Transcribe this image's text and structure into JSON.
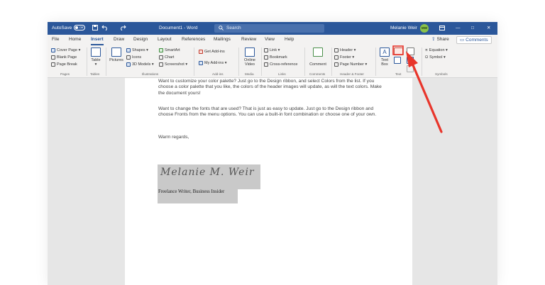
{
  "titlebar": {
    "autosave": "AutoSave",
    "autosave_state": "Off",
    "document_name": "Document1  -  Word",
    "search_placeholder": "Search",
    "user_name": "Melanie Weir",
    "user_initials": "MW",
    "minimize": "—",
    "restore": "□",
    "close": "✕"
  },
  "menu": {
    "tabs": [
      "File",
      "Home",
      "Insert",
      "Draw",
      "Design",
      "Layout",
      "References",
      "Mailings",
      "Review",
      "View",
      "Help"
    ],
    "active": "Insert",
    "share": "Share",
    "comments": "Comments"
  },
  "ribbon": {
    "pages": {
      "cover_page": "Cover Page",
      "blank_page": "Blank Page",
      "page_break": "Page Break",
      "label": "Pages"
    },
    "tables": {
      "table": "Table",
      "label": "Tables"
    },
    "illustrations": {
      "pictures": "Pictures",
      "shapes": "Shapes",
      "icons": "Icons",
      "models_3d": "3D Models",
      "smartart": "SmartArt",
      "chart": "Chart",
      "screenshot": "Screenshot",
      "label": "Illustrations"
    },
    "addins": {
      "get_addins": "Get Add-ins",
      "my_addins": "My Add-ins",
      "label": "Add-ins"
    },
    "media": {
      "online_video": "Online Video",
      "label": "Media"
    },
    "links": {
      "link": "Link",
      "bookmark": "Bookmark",
      "cross_reference": "Cross-reference",
      "label": "Links"
    },
    "comments": {
      "comment": "Comment",
      "label": "Comments"
    },
    "header_footer": {
      "header": "Header",
      "footer": "Footer",
      "page_number": "Page Number",
      "label": "Header & Footer"
    },
    "text": {
      "text_box": "Text Box",
      "label": "Text"
    },
    "symbols": {
      "equation": "Equation",
      "symbol": "Symbol",
      "label": "Symbols"
    }
  },
  "document": {
    "para1": "Want to customize your color palette?  Just go to the Design ribbon, and select Colors from the list.  If you choose a color palette that you like, the colors of the header images will update, as will the text colors.  Make the document yours!",
    "para2": "Want to change the fonts that are used?  That is just as easy to update.  Just go to the Design ribbon and choose Fronts from the menu options.  You can use a built-in font combination or choose one of your own.",
    "closing": "Warm regards,",
    "signature": "Melanie M. Weir",
    "caption": "Freelance Writer, Business Insider"
  },
  "colors": {
    "word_blue": "#2b579a",
    "ribbon_bg": "#f3f2f1",
    "canvas_bg": "#e6e6e6",
    "annotation_red": "#e8352b"
  },
  "icons": [
    "save-icon",
    "undo-icon",
    "redo-icon",
    "search-icon",
    "minimize-icon",
    "restore-icon",
    "close-icon",
    "wordart-icon",
    "signature-line-icon",
    "arrow-annotation"
  ]
}
